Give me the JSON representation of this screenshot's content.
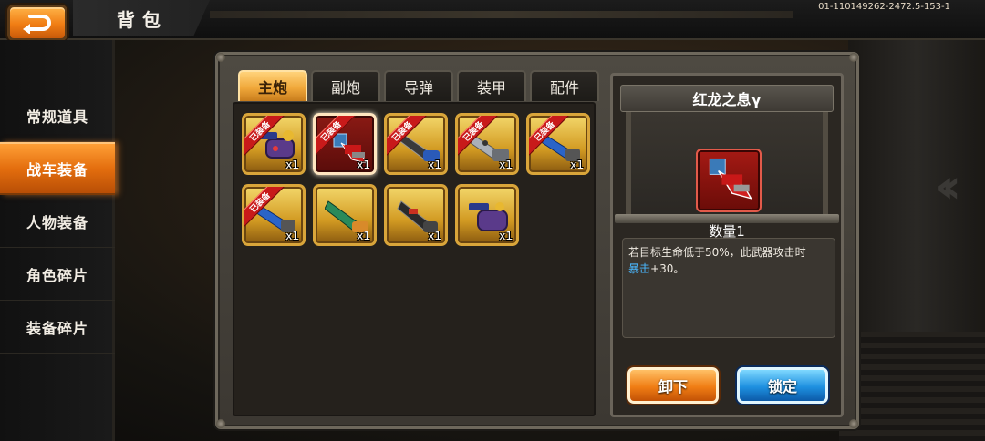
{
  "header": {
    "title": "背包",
    "build_id": "01-110149262-2472.5-153-1",
    "back_icon": "back-arrow-icon"
  },
  "sidebar": {
    "items": [
      {
        "label": "常规道具",
        "active": false
      },
      {
        "label": "战车装备",
        "active": true
      },
      {
        "label": "人物装备",
        "active": false
      },
      {
        "label": "角色碎片",
        "active": false
      },
      {
        "label": "装备碎片",
        "active": false
      }
    ]
  },
  "tabs": [
    {
      "label": "主炮",
      "active": true
    },
    {
      "label": "副炮",
      "active": false
    },
    {
      "label": "导弹",
      "active": false
    },
    {
      "label": "装甲",
      "active": false
    },
    {
      "label": "配件",
      "active": false
    }
  ],
  "items": [
    {
      "equipped_label": "已装备",
      "qty": "x1",
      "icon": "purple-cannon-icon",
      "selected": false
    },
    {
      "equipped_label": "已装备",
      "qty": "x1",
      "icon": "red-dragon-cannon-icon",
      "selected": true
    },
    {
      "equipped_label": "已装备",
      "qty": "x1",
      "icon": "blue-cannon-icon",
      "selected": false
    },
    {
      "equipped_label": "已装备",
      "qty": "x1",
      "icon": "silver-cannon-icon",
      "selected": false
    },
    {
      "equipped_label": "已装备",
      "qty": "x1",
      "icon": "blue-barrel-cannon-icon",
      "selected": false
    },
    {
      "equipped_label": "已装备",
      "qty": "x1",
      "icon": "blue-barrel-cannon-icon",
      "selected": false
    },
    {
      "equipped_label": "",
      "qty": "x1",
      "icon": "green-cannon-icon",
      "selected": false
    },
    {
      "equipped_label": "",
      "qty": "x1",
      "icon": "black-cannon-icon",
      "selected": false
    },
    {
      "equipped_label": "",
      "qty": "x1",
      "icon": "purple-cannon-icon",
      "selected": false
    }
  ],
  "detail": {
    "name": "红龙之息γ",
    "quantity": "数量1",
    "desc_prefix": "若目标生命低于50%，此武器攻击时",
    "desc_highlight": "暴击",
    "desc_suffix": "+30。",
    "icon": "red-dragon-cannon-icon",
    "unequip_label": "卸下",
    "lock_label": "锁定"
  },
  "colors": {
    "accent_orange": "#f07d14",
    "accent_blue": "#1e90e0",
    "crit_blue": "#4ab8ff",
    "equipped_red": "#c81a1a"
  }
}
